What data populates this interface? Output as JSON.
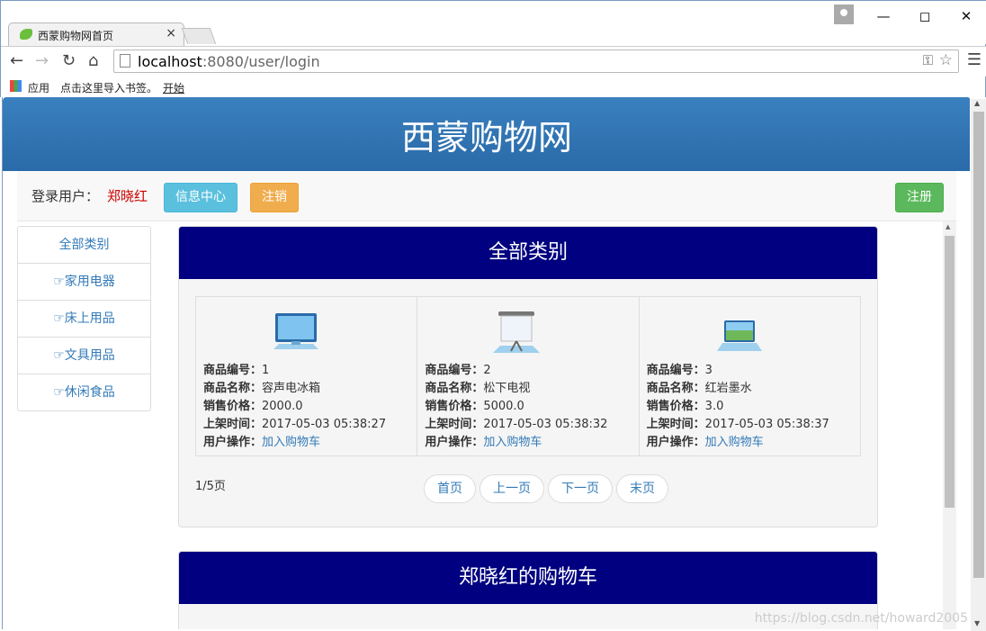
{
  "browser": {
    "tab_title": "西蒙购物网首页",
    "tab_close": "×",
    "url_host": "localhost",
    "url_rest": ":8080/user/login",
    "bookmarks": {
      "apps": "应用",
      "import": "点击这里导入书签。",
      "start": "开始"
    }
  },
  "header": {
    "title": "西蒙购物网"
  },
  "userbar": {
    "label": "登录用户：",
    "username": "郑晓红",
    "info_button": "信息中心",
    "logout_button": "注销",
    "register_button": "注册"
  },
  "sidebar": {
    "items": [
      {
        "label": "全部类别"
      },
      {
        "label": "☞家用电器"
      },
      {
        "label": "☞床上用品"
      },
      {
        "label": "☞文具用品"
      },
      {
        "label": "☞休闲食品"
      }
    ]
  },
  "catalog": {
    "title": "全部类别",
    "labels": {
      "id": "商品编号：",
      "name": "商品名称：",
      "price": "销售价格：",
      "time": "上架时间：",
      "action": "用户操作："
    },
    "products": [
      {
        "id": "1",
        "name": "容声电冰箱",
        "price": "2000.0",
        "time": "2017-05-03 05:38:27",
        "action": "加入购物车",
        "icon": "monitor-icon"
      },
      {
        "id": "2",
        "name": "松下电视",
        "price": "5000.0",
        "time": "2017-05-03 05:38:32",
        "action": "加入购物车",
        "icon": "projector-screen-icon"
      },
      {
        "id": "3",
        "name": "红岩墨水",
        "price": "3.0",
        "time": "2017-05-03 05:38:37",
        "action": "加入购物车",
        "icon": "laptop-icon"
      }
    ],
    "page_info": "1/5页",
    "pager": {
      "first": "首页",
      "prev": "上一页",
      "next": "下一页",
      "last": "末页"
    }
  },
  "cart": {
    "title": "郑晓红的购物车"
  },
  "watermark": "https://blog.csdn.net/howard2005"
}
